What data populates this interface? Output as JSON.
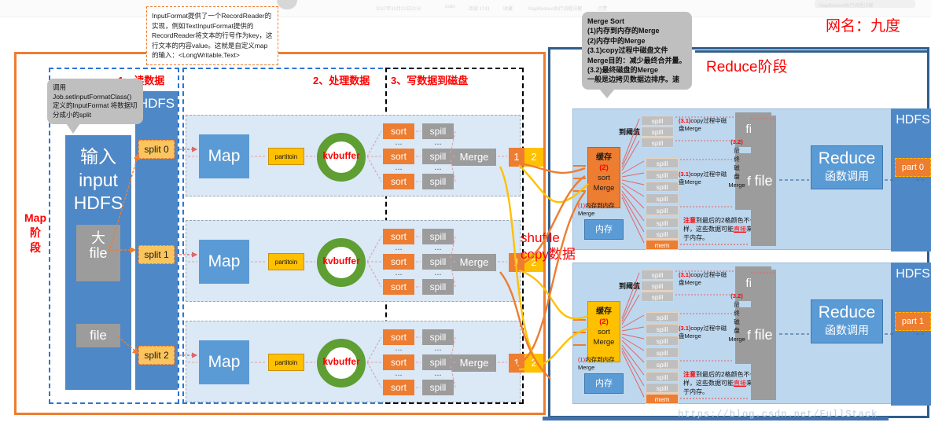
{
  "title_right": "网名：九度",
  "top_remnants": [
    "关注",
    "2017年10月21日21分",
    "csdn",
    "阅读 1741",
    "收藏",
    "MapReduce执行流程详解",
    "点赞"
  ],
  "callouts": {
    "inputformat": "InputFormat提供了一个RecordReader的实现，例如TextInputFormat提供的RecordReader将文本的行号作为key，这行文本的内容value。这就是自定义map的输入：<LongWritable,Text>",
    "split": "调用 Job.setInputFormatClass()定义的InputFormat 将数据切分成小的split",
    "merge_sort": "Merge Sort\n(1)内存到内存的Merge\n(2)内存中的Merge\n(3.1)copy过程中磁盘文件 Merge目的：减少最终合并量。\n(3.2)最终磁盘的Merge\n一般是边拷贝数据边排序。速"
  },
  "map_stage": {
    "stage_label": "Map\n阶\n段",
    "sections": [
      {
        "label": "1、读数据"
      },
      {
        "label": "2、处理数据"
      },
      {
        "label": "3、写数据到磁盘"
      }
    ],
    "input": {
      "line1": "输入",
      "line2": "input",
      "line3": "HDFS",
      "big_file": "大\nfile",
      "small_file": "file"
    },
    "hdfs_label": "HDFS",
    "splits": [
      "split 0",
      "split 1",
      "split 2"
    ],
    "rows": [
      {
        "map": "Map",
        "partition": "partitoin",
        "kvbuffer": "kvbuffer",
        "sort": "sort",
        "spill": "spill",
        "ellipsis": "...",
        "merge": "Merge",
        "out1": "1",
        "out2": "2"
      },
      {
        "map": "Map",
        "partition": "partitoin",
        "kvbuffer": "kvbuffer",
        "sort": "sort",
        "spill": "spill",
        "ellipsis": "...",
        "merge": "Merge",
        "out1": "1",
        "out2": "2"
      },
      {
        "map": "Map",
        "partition": "partitoin",
        "kvbuffer": "kvbuffer",
        "sort": "sort",
        "spill": "spill",
        "ellipsis": "...",
        "merge": "Merge",
        "out1": "1",
        "out2": "2"
      }
    ]
  },
  "shuffle": {
    "line1": "shuffle",
    "line2": "copy数据"
  },
  "reduce_stage": {
    "title": "Reduce阶段",
    "rows": [
      {
        "threshold": "到阈值",
        "cache": {
          "name": "缓存",
          "num": "(2)",
          "sort": "sort",
          "merge": "Merge"
        },
        "mem_label": "(1)内存到内存 Merge",
        "mem_box": "内存",
        "spill": "spill",
        "mem_cell": "mem",
        "copy_note": "(3.1)copy过程中磁盘Merge",
        "file": "file",
        "final_note": "(3.2) 最终磁盘 Merge",
        "final_file": "file",
        "warn": "注意到最后的2格颜色不一样，这些数据可能直接来自于内存。",
        "reduce": {
          "line1": "Reduce",
          "line2": "函数调用"
        },
        "hdfs": "HDFS",
        "part": "part 0"
      },
      {
        "threshold": "到阈值",
        "cache": {
          "name": "缓存",
          "num": "(2)",
          "sort": "sort",
          "merge": "Merge"
        },
        "mem_label": "(1)内存到内存 Merge",
        "mem_box": "内存",
        "spill": "spill",
        "mem_cell": "mem",
        "copy_note": "(3.1)copy过程中磁盘Merge",
        "file": "file",
        "final_note": "(3.2) 最终磁盘 Merge",
        "final_file": "file",
        "warn": "注意到最后的2格颜色不一样，这些数据可能直接来自于内存。",
        "reduce": {
          "line1": "Reduce",
          "line2": "函数调用"
        },
        "hdfs": "HDFS",
        "part": "part 1"
      }
    ]
  },
  "watermark": "https://blog.csdn.net/FullStack",
  "colors": {
    "map_frame": "#ED7D31",
    "reduce_frame": "#2E5E8E",
    "accent_red": "#FF0000",
    "blue_block": "#4F88C6",
    "map_box": "#5B9BD5",
    "sort_orange": "#ED7D31",
    "spill_gray": "#9C9C9C",
    "kv_green": "#5E9E32",
    "split_yellow": "#FBC55E",
    "row_bg": "#DBE8F6",
    "reduce_row_bg": "#BDD7EE"
  }
}
